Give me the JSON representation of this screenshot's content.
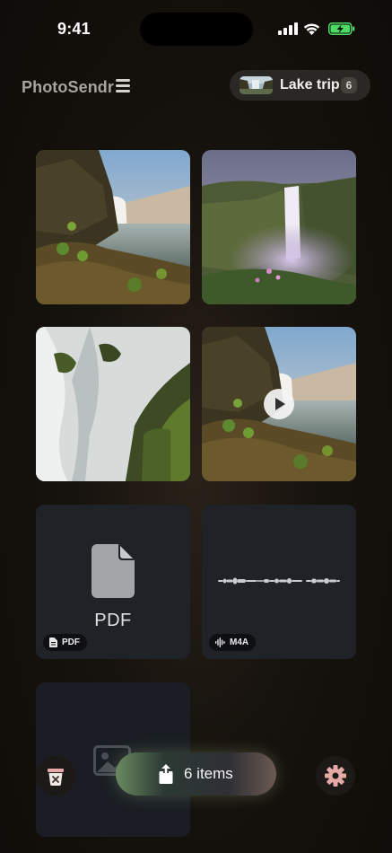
{
  "status_bar": {
    "time": "9:41"
  },
  "header": {
    "app_title": "PhotoSendr",
    "album": {
      "name": "Lake trip",
      "count": "6"
    }
  },
  "tiles": [
    {
      "kind": "photo",
      "subject": "waterfall over lake with grassy cliff"
    },
    {
      "kind": "photo",
      "subject": "misty waterfall with purple flowers"
    },
    {
      "kind": "photo",
      "subject": "long-exposure cascade over mossy rocks"
    },
    {
      "kind": "video",
      "subject": "waterfall over lake with grassy cliff"
    },
    {
      "kind": "document",
      "center_label": "PDF",
      "badge": "PDF"
    },
    {
      "kind": "audio",
      "badge": "M4A"
    },
    {
      "kind": "image-placeholder"
    }
  ],
  "bottom_bar": {
    "send_label": "6 items"
  },
  "icons": {
    "menu": "hamburger-icon",
    "clear": "clear-selection-icon",
    "send": "share-icon",
    "settings": "gear-icon",
    "play": "play-icon",
    "document": "document-icon",
    "audio": "waveform-icon",
    "image": "image-icon"
  },
  "colors": {
    "background": "#16120d",
    "tile_dark": "#1f2328",
    "battery_green": "#4cd964",
    "accent_clear": "#e8a9a9"
  }
}
